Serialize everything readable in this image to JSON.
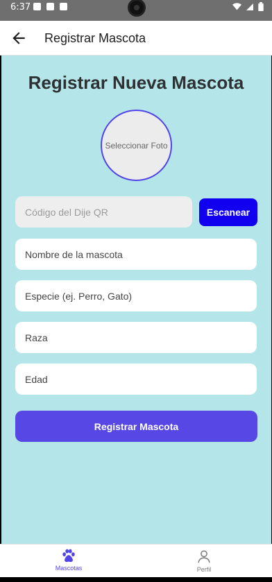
{
  "status_bar": {
    "time": "6:37"
  },
  "app_bar": {
    "title": "Registrar Mascota",
    "back_icon": "arrow-left-icon"
  },
  "main": {
    "heading": "Registrar Nueva Mascota",
    "photo_label": "Seleccionar Foto",
    "qr_placeholder": "Código del Dije QR",
    "scan_label": "Escanear",
    "fields": {
      "name": "Nombre de la mascota",
      "species": "Especie (ej. Perro, Gato)",
      "breed": "Raza",
      "age": "Edad"
    },
    "submit_label": "Registrar Mascota"
  },
  "bottom_nav": {
    "items": [
      {
        "label": "Mascotas",
        "icon": "paw-icon",
        "active": true
      },
      {
        "label": "Perfil",
        "icon": "person-icon",
        "active": false
      }
    ]
  },
  "colors": {
    "background": "#b4e6e9",
    "accent": "#5748e6",
    "scan_button": "#1100f0",
    "active_nav": "#5143e8"
  }
}
